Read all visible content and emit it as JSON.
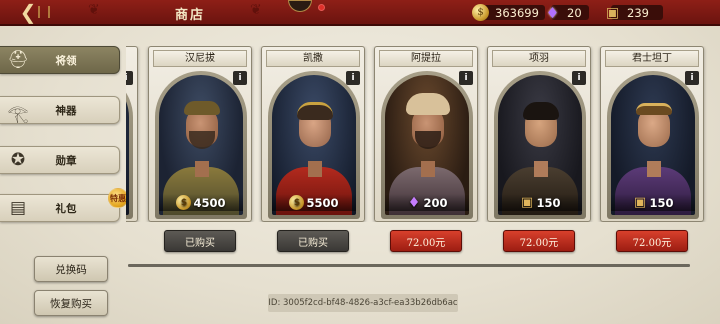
{
  "header": {
    "title": "商店",
    "back_icon": "back-arrow-icon",
    "resources": [
      {
        "icon": "coin-icon",
        "value": "363699"
      },
      {
        "icon": "gem-icon",
        "value": "20"
      },
      {
        "icon": "chest-icon",
        "value": "239"
      }
    ]
  },
  "sidebar": {
    "items": [
      {
        "label": "将领",
        "icon": "helmet-icon",
        "active": true
      },
      {
        "label": "神器",
        "icon": "eye-of-horus-icon",
        "active": false
      },
      {
        "label": "勋章",
        "icon": "eagle-medal-icon",
        "active": false
      },
      {
        "label": "礼包",
        "icon": "gift-pack-icon",
        "active": false
      }
    ],
    "sale_tag": "特惠",
    "redeem_button": "兑换码",
    "restore_button": "恢复购买"
  },
  "cards": [
    {
      "name": "汉尼拔",
      "price": "4500",
      "currency": "coin",
      "button": "已购买",
      "owned": true
    },
    {
      "name": "凯撒",
      "price": "5500",
      "currency": "coin",
      "button": "已购买",
      "owned": true
    },
    {
      "name": "阿提拉",
      "price": "200",
      "currency": "gem",
      "button": "72.00元",
      "owned": false
    },
    {
      "name": "项羽",
      "price": "150",
      "currency": "chest",
      "button": "72.00元",
      "owned": false
    },
    {
      "name": "君士坦丁",
      "price": "150",
      "currency": "chest",
      "button": "72.00元",
      "owned": false
    }
  ],
  "footer": {
    "id_text": "ID: 3005f2cd-bf48-4826-a3cf-ea33b26db6ac"
  }
}
